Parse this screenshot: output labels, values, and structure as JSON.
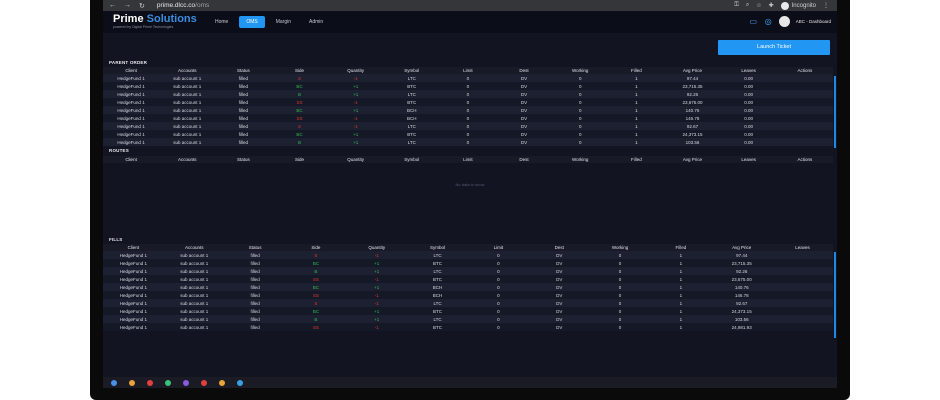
{
  "browser": {
    "url_host": "prime.dlcc.co",
    "url_path": "/oms",
    "profile_label": "Incognito"
  },
  "app": {
    "logo_main": "Prime",
    "logo_accent": "Solutions",
    "logo_sub": "powered by Digital Prime Technologies",
    "nav": [
      "Home",
      "OMS",
      "Margin",
      "Admin"
    ],
    "active_nav": "OMS",
    "user_label": "ABC - Dashboard"
  },
  "launch_label": "Launch Ticket",
  "colors": {
    "accent": "#2196f3",
    "buy": "#2ebd52",
    "sell": "#e3362e"
  },
  "parent_order": {
    "title": "PARENT ORDER",
    "columns": [
      "Client",
      "Accounts",
      "Status",
      "Side",
      "Quantity",
      "Symbol",
      "Limit",
      "Dest",
      "Working",
      "Filled",
      "Avg Price",
      "Leaves",
      "Actions"
    ],
    "rows": [
      [
        "HedgeFund 1",
        "sub account 1",
        "filled",
        "S",
        "-1",
        "LTC",
        "0",
        "DV",
        "0",
        "1",
        "97.44",
        "0.00",
        ""
      ],
      [
        "HedgeFund 1",
        "sub account 1",
        "filled",
        "BC",
        "+1",
        "BTC",
        "0",
        "DV",
        "0",
        "1",
        "23,715.35",
        "0.00",
        ""
      ],
      [
        "HedgeFund 1",
        "sub account 1",
        "filled",
        "B",
        "+1",
        "LTC",
        "0",
        "DV",
        "0",
        "1",
        "92.26",
        "0.00",
        ""
      ],
      [
        "HedgeFund 1",
        "sub account 1",
        "filled",
        "SS",
        "-1",
        "BTC",
        "0",
        "DV",
        "0",
        "1",
        "23,675.00",
        "0.00",
        ""
      ],
      [
        "HedgeFund 1",
        "sub account 1",
        "filled",
        "BC",
        "+1",
        "BCH",
        "0",
        "DV",
        "0",
        "1",
        "140.76",
        "0.00",
        ""
      ],
      [
        "HedgeFund 1",
        "sub account 1",
        "filled",
        "SS",
        "-1",
        "BCH",
        "0",
        "DV",
        "0",
        "1",
        "146.78",
        "0.00",
        ""
      ],
      [
        "HedgeFund 1",
        "sub account 1",
        "filled",
        "S",
        "-1",
        "LTC",
        "0",
        "DV",
        "0",
        "1",
        "92.67",
        "0.00",
        ""
      ],
      [
        "HedgeFund 1",
        "sub account 1",
        "filled",
        "BC",
        "+1",
        "BTC",
        "0",
        "DV",
        "0",
        "1",
        "24,373.15",
        "0.00",
        ""
      ],
      [
        "HedgeFund 1",
        "sub account 1",
        "filled",
        "B",
        "+1",
        "LTC",
        "0",
        "DV",
        "0",
        "1",
        "103.56",
        "0.00",
        ""
      ]
    ]
  },
  "routes": {
    "title": "ROUTES",
    "columns": [
      "Client",
      "Accounts",
      "Status",
      "Side",
      "Quantity",
      "Symbol",
      "Limit",
      "Dest",
      "Working",
      "Filled",
      "Avg Price",
      "Leaves",
      "Actions"
    ],
    "empty_text": "No data to show"
  },
  "fills": {
    "title": "FILLS",
    "columns": [
      "Client",
      "Accounts",
      "Status",
      "Side",
      "Quantity",
      "Symbol",
      "Limit",
      "Dest",
      "Working",
      "Filled",
      "Avg Price",
      "Leaves"
    ],
    "rows": [
      [
        "HedgeFund 1",
        "sub account 1",
        "filled",
        "S",
        "-1",
        "LTC",
        "0",
        "DV",
        "0",
        "1",
        "97.44",
        ""
      ],
      [
        "HedgeFund 1",
        "sub account 1",
        "filled",
        "BC",
        "+1",
        "BTC",
        "0",
        "DV",
        "0",
        "1",
        "23,715.35",
        ""
      ],
      [
        "HedgeFund 1",
        "sub account 1",
        "filled",
        "B",
        "+1",
        "LTC",
        "0",
        "DV",
        "0",
        "1",
        "92.26",
        ""
      ],
      [
        "HedgeFund 1",
        "sub account 1",
        "filled",
        "SS",
        "-1",
        "BTC",
        "0",
        "DV",
        "0",
        "1",
        "23,675.00",
        ""
      ],
      [
        "HedgeFund 1",
        "sub account 1",
        "filled",
        "BC",
        "+1",
        "BCH",
        "0",
        "DV",
        "0",
        "1",
        "140.76",
        ""
      ],
      [
        "HedgeFund 1",
        "sub account 1",
        "filled",
        "SS",
        "-1",
        "BCH",
        "0",
        "DV",
        "0",
        "1",
        "146.78",
        ""
      ],
      [
        "HedgeFund 1",
        "sub account 1",
        "filled",
        "S",
        "-1",
        "LTC",
        "0",
        "DV",
        "0",
        "1",
        "92.67",
        ""
      ],
      [
        "HedgeFund 1",
        "sub account 1",
        "filled",
        "BC",
        "+1",
        "BTC",
        "0",
        "DV",
        "0",
        "1",
        "24,373.15",
        ""
      ],
      [
        "HedgeFund 1",
        "sub account 1",
        "filled",
        "B",
        "+1",
        "LTC",
        "0",
        "DV",
        "0",
        "1",
        "103.56",
        ""
      ],
      [
        "HedgeFund 1",
        "sub account 1",
        "filled",
        "SS",
        "-1",
        "BTC",
        "0",
        "DV",
        "0",
        "1",
        "24,981.93",
        ""
      ]
    ]
  }
}
